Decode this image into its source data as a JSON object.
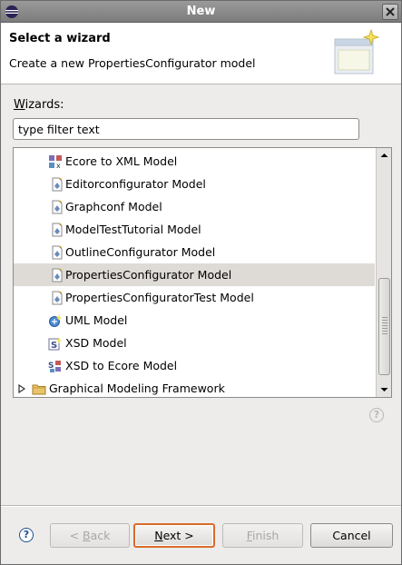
{
  "window": {
    "title": "New"
  },
  "banner": {
    "heading": "Select a wizard",
    "description": "Create a new PropertiesConfigurator model"
  },
  "wizards": {
    "label_mnemonic": "W",
    "label_rest": "izards:",
    "filter_value": "type filter text",
    "items": [
      {
        "label": "Ecore to XML Model",
        "icon": "ecore-to-xml-icon",
        "selected": false
      },
      {
        "label": "Editorconfigurator Model",
        "icon": "model-file-icon",
        "selected": false
      },
      {
        "label": "Graphconf Model",
        "icon": "model-file-icon",
        "selected": false
      },
      {
        "label": "ModelTestTutorial Model",
        "icon": "model-file-icon",
        "selected": false
      },
      {
        "label": "OutlineConfigurator Model",
        "icon": "model-file-icon",
        "selected": false
      },
      {
        "label": "PropertiesConfigurator Model",
        "icon": "model-file-icon",
        "selected": true
      },
      {
        "label": "PropertiesConfiguratorTest Model",
        "icon": "model-file-icon",
        "selected": false
      },
      {
        "label": "UML Model",
        "icon": "uml-model-icon",
        "selected": false
      },
      {
        "label": "XSD Model",
        "icon": "xsd-model-icon",
        "selected": false
      },
      {
        "label": "XSD to Ecore Model",
        "icon": "xsd-to-ecore-icon",
        "selected": false
      }
    ],
    "folder": {
      "label": "Graphical Modeling Framework",
      "icon": "folder-icon",
      "expanded": false
    }
  },
  "buttons": {
    "help": "?",
    "back_prefix": "< ",
    "back_mnemonic": "B",
    "back_rest": "ack",
    "next_mnemonic": "N",
    "next_rest": "ext >",
    "finish_mnemonic": "F",
    "finish_rest": "inish",
    "cancel": "Cancel"
  },
  "colors": {
    "selection": "#dedad6",
    "default_button_border": "#d96a2b",
    "titlebar": "#8a8a8a"
  }
}
